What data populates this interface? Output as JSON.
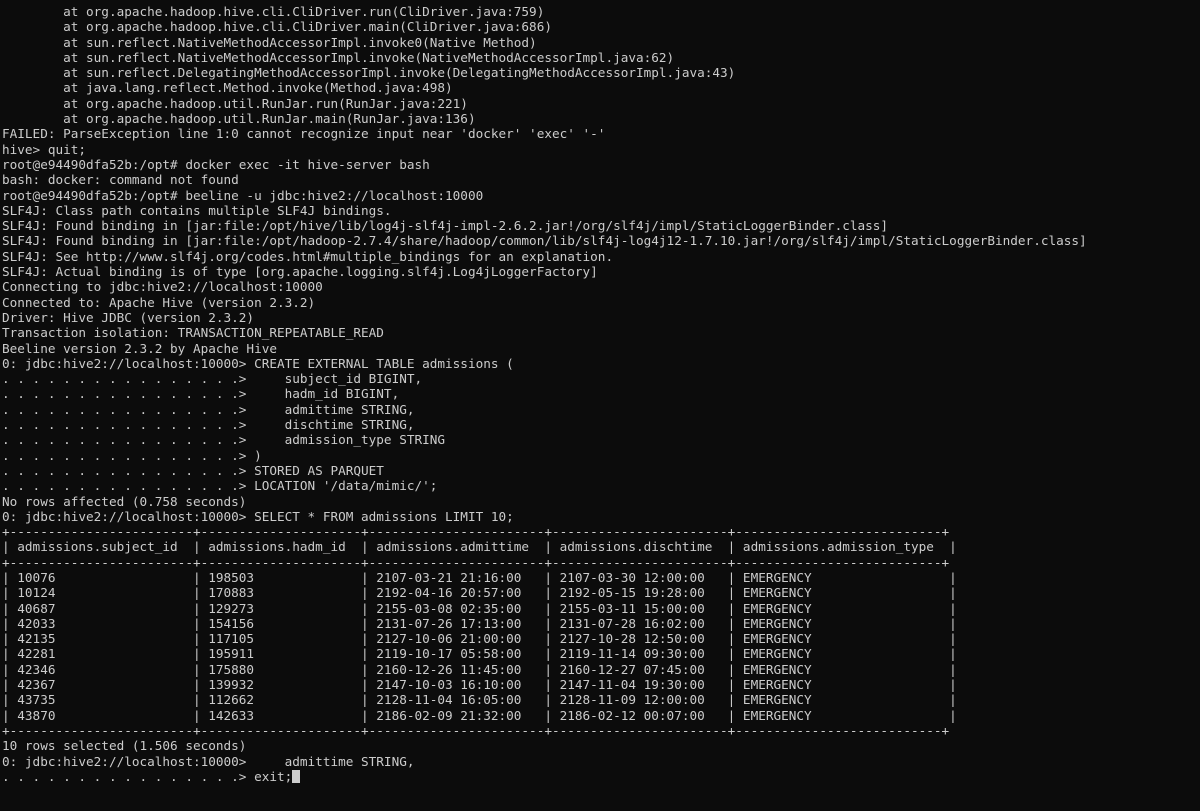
{
  "terminal": {
    "lines": [
      "        at org.apache.hadoop.hive.cli.CliDriver.run(CliDriver.java:759)",
      "        at org.apache.hadoop.hive.cli.CliDriver.main(CliDriver.java:686)",
      "        at sun.reflect.NativeMethodAccessorImpl.invoke0(Native Method)",
      "        at sun.reflect.NativeMethodAccessorImpl.invoke(NativeMethodAccessorImpl.java:62)",
      "        at sun.reflect.DelegatingMethodAccessorImpl.invoke(DelegatingMethodAccessorImpl.java:43)",
      "        at java.lang.reflect.Method.invoke(Method.java:498)",
      "        at org.apache.hadoop.util.RunJar.run(RunJar.java:221)",
      "        at org.apache.hadoop.util.RunJar.main(RunJar.java:136)",
      "FAILED: ParseException line 1:0 cannot recognize input near 'docker' 'exec' '-'",
      "hive> quit;",
      "root@e94490dfa52b:/opt# docker exec -it hive-server bash",
      "bash: docker: command not found",
      "root@e94490dfa52b:/opt# beeline -u jdbc:hive2://localhost:10000",
      "SLF4J: Class path contains multiple SLF4J bindings.",
      "SLF4J: Found binding in [jar:file:/opt/hive/lib/log4j-slf4j-impl-2.6.2.jar!/org/slf4j/impl/StaticLoggerBinder.class]",
      "SLF4J: Found binding in [jar:file:/opt/hadoop-2.7.4/share/hadoop/common/lib/slf4j-log4j12-1.7.10.jar!/org/slf4j/impl/StaticLoggerBinder.class]",
      "SLF4J: See http://www.slf4j.org/codes.html#multiple_bindings for an explanation.",
      "SLF4J: Actual binding is of type [org.apache.logging.slf4j.Log4jLoggerFactory]",
      "Connecting to jdbc:hive2://localhost:10000",
      "Connected to: Apache Hive (version 2.3.2)",
      "Driver: Hive JDBC (version 2.3.2)",
      "Transaction isolation: TRANSACTION_REPEATABLE_READ",
      "Beeline version 2.3.2 by Apache Hive",
      "0: jdbc:hive2://localhost:10000> CREATE EXTERNAL TABLE admissions (",
      ". . . . . . . . . . . . . . . .>     subject_id BIGINT,",
      ". . . . . . . . . . . . . . . .>     hadm_id BIGINT,",
      ". . . . . . . . . . . . . . . .>     admittime STRING,",
      ". . . . . . . . . . . . . . . .>     dischtime STRING,",
      ". . . . . . . . . . . . . . . .>     admission_type STRING",
      ". . . . . . . . . . . . . . . .> )",
      ". . . . . . . . . . . . . . . .> STORED AS PARQUET",
      ". . . . . . . . . . . . . . . .> LOCATION '/data/mimic/';",
      "No rows affected (0.758 seconds)",
      "0: jdbc:hive2://localhost:10000> SELECT * FROM admissions LIMIT 10;",
      "+------------------------+---------------------+-----------------------+-----------------------+---------------------------+",
      "| admissions.subject_id  | admissions.hadm_id  | admissions.admittime  | admissions.dischtime  | admissions.admission_type  |",
      "+------------------------+---------------------+-----------------------+-----------------------+---------------------------+",
      "| 10076                  | 198503              | 2107-03-21 21:16:00   | 2107-03-30 12:00:00   | EMERGENCY                  |",
      "| 10124                  | 170883              | 2192-04-16 20:57:00   | 2192-05-15 19:28:00   | EMERGENCY                  |",
      "| 40687                  | 129273              | 2155-03-08 02:35:00   | 2155-03-11 15:00:00   | EMERGENCY                  |",
      "| 42033                  | 154156              | 2131-07-26 17:13:00   | 2131-07-28 16:02:00   | EMERGENCY                  |",
      "| 42135                  | 117105              | 2127-10-06 21:00:00   | 2127-10-28 12:50:00   | EMERGENCY                  |",
      "| 42281                  | 195911              | 2119-10-17 05:58:00   | 2119-11-14 09:30:00   | EMERGENCY                  |",
      "| 42346                  | 175880              | 2160-12-26 11:45:00   | 2160-12-27 07:45:00   | EMERGENCY                  |",
      "| 42367                  | 139932              | 2147-10-03 16:10:00   | 2147-11-04 19:30:00   | EMERGENCY                  |",
      "| 43735                  | 112662              | 2128-11-04 16:05:00   | 2128-11-09 12:00:00   | EMERGENCY                  |",
      "| 43870                  | 142633              | 2186-02-09 21:32:00   | 2186-02-12 00:07:00   | EMERGENCY                  |",
      "+------------------------+---------------------+-----------------------+-----------------------+---------------------------+",
      "10 rows selected (1.506 seconds)",
      "0: jdbc:hive2://localhost:10000>     admittime STRING,",
      ". . . . . . . . . . . . . . . .> exit;"
    ]
  }
}
